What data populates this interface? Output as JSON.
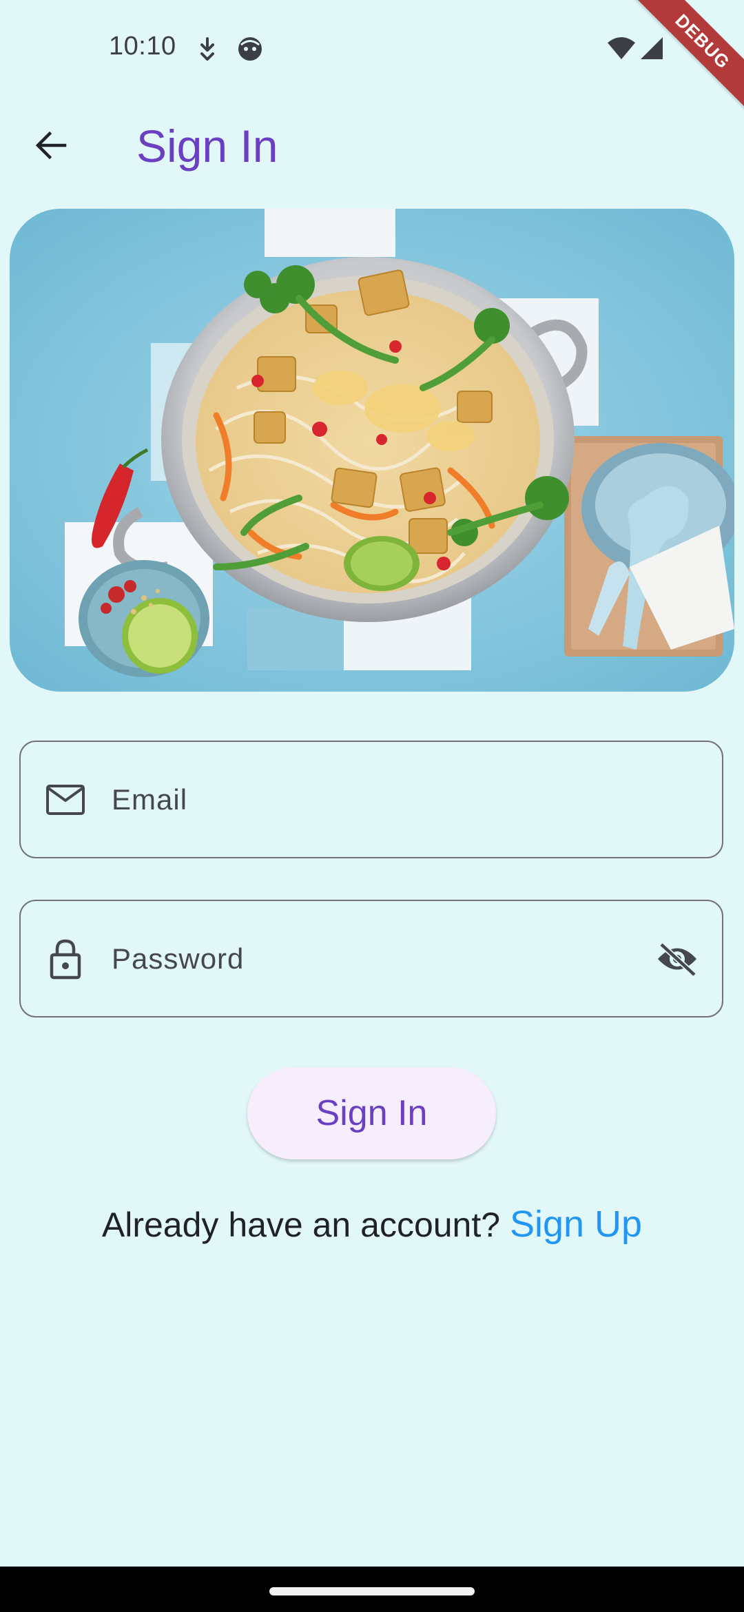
{
  "status_bar": {
    "time": "10:10",
    "icons": [
      "download-notification-icon",
      "face-notification-icon",
      "wifi-icon",
      "cell-signal-icon"
    ]
  },
  "debug_banner": "DEBUG",
  "app_bar": {
    "back_icon": "arrow-back-icon",
    "title": "Sign In"
  },
  "hero_image": {
    "subject": "food-bowl-image"
  },
  "form": {
    "email": {
      "placeholder": "Email",
      "value": "",
      "icon": "mail-icon"
    },
    "password": {
      "placeholder": "Password",
      "value": "",
      "icon": "lock-icon",
      "toggle_icon": "visibility-off-icon"
    },
    "submit_label": "Sign In"
  },
  "footer": {
    "prompt": "Already have an account?",
    "link": "Sign Up"
  },
  "colors": {
    "background": "#E2F7F8",
    "accent": "#6A3FC1",
    "link": "#2196F3",
    "button_bg": "#F6EEFC",
    "debug": "#B33A3A"
  }
}
